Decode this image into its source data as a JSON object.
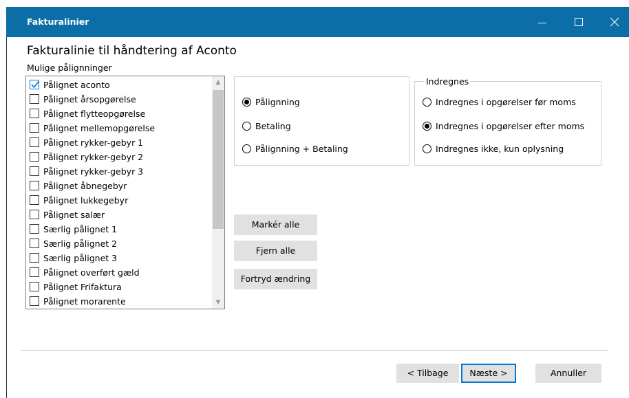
{
  "window": {
    "title": "Fakturalinier"
  },
  "heading": "Fakturalinie til håndtering af Aconto",
  "list_label": "Mulige pålignninger",
  "list_items": [
    {
      "label": "Pålignet aconto",
      "checked": true
    },
    {
      "label": "Pålignet årsopgørelse",
      "checked": false
    },
    {
      "label": "Pålignet flytteopgørelse",
      "checked": false
    },
    {
      "label": "Pålignet mellemopgørelse",
      "checked": false
    },
    {
      "label": "Pålignet rykker-gebyr 1",
      "checked": false
    },
    {
      "label": "Pålignet rykker-gebyr 2",
      "checked": false
    },
    {
      "label": "Pålignet rykker-gebyr 3",
      "checked": false
    },
    {
      "label": "Pålignet åbnegebyr",
      "checked": false
    },
    {
      "label": "Pålignet lukkegebyr",
      "checked": false
    },
    {
      "label": "Pålignet salær",
      "checked": false
    },
    {
      "label": "Særlig pålignet 1",
      "checked": false
    },
    {
      "label": "Særlig pålignet 2",
      "checked": false
    },
    {
      "label": "Særlig pålignet 3",
      "checked": false
    },
    {
      "label": "Pålignet overført gæld",
      "checked": false
    },
    {
      "label": "Pålignet Frifaktura",
      "checked": false
    },
    {
      "label": "Pålignet morarente",
      "checked": false
    }
  ],
  "type_options": [
    {
      "label": "Pålignning",
      "selected": true
    },
    {
      "label": "Betaling",
      "selected": false
    },
    {
      "label": "Pålignning + Betaling",
      "selected": false
    }
  ],
  "indregnes": {
    "legend": "Indregnes",
    "options": [
      {
        "label": "Indregnes i opgørelser før moms",
        "selected": false
      },
      {
        "label": "Indregnes i opgørelser efter moms",
        "selected": true
      },
      {
        "label": "Indregnes ikke, kun oplysning",
        "selected": false
      }
    ]
  },
  "buttons": {
    "mark_all": "Markér alle",
    "remove_all": "Fjern alle",
    "undo": "Fortryd ændring",
    "back": "< Tilbage",
    "next": "Næste >",
    "cancel": "Annuller"
  },
  "colors": {
    "titlebar": "#0b6ea6",
    "accent": "#0078d7"
  }
}
